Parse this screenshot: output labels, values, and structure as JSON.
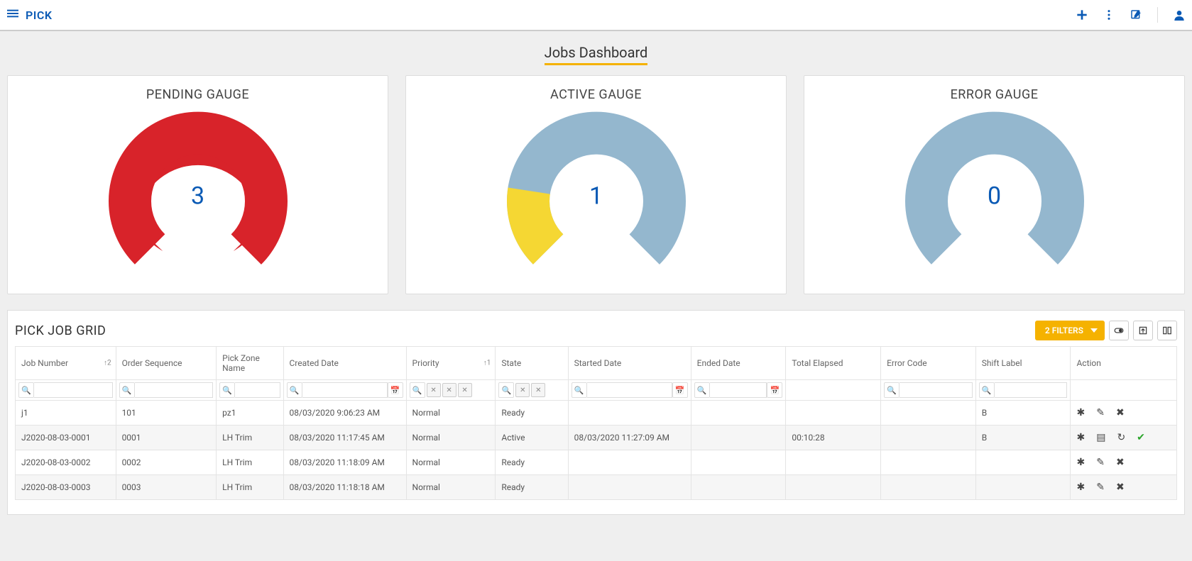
{
  "header": {
    "title": "PICK"
  },
  "dashboard": {
    "title": "Jobs Dashboard",
    "gauges": [
      {
        "label": "PENDING GAUGE",
        "value": "3"
      },
      {
        "label": "ACTIVE GAUGE",
        "value": "1"
      },
      {
        "label": "ERROR GAUGE",
        "value": "0"
      }
    ]
  },
  "grid": {
    "title": "PICK JOB GRID",
    "filters_label": "2 FILTERS",
    "columns": {
      "job_number": "Job Number",
      "order_sequence": "Order Sequence",
      "pick_zone": "Pick Zone Name",
      "created_date": "Created Date",
      "priority": "Priority",
      "state": "State",
      "started_date": "Started Date",
      "ended_date": "Ended Date",
      "total_elapsed": "Total Elapsed",
      "error_code": "Error Code",
      "shift_label": "Shift Label",
      "action": "Action",
      "sort_job": "↑2",
      "sort_prio": "↑1"
    },
    "rows": [
      {
        "job_number": "j1",
        "order_sequence": "101",
        "pick_zone": "pz1",
        "created_date": "08/03/2020 9:06:23 AM",
        "priority": "Normal",
        "state": "Ready",
        "started_date": "",
        "ended_date": "",
        "total_elapsed": "",
        "error_code": "",
        "shift_label": "B"
      },
      {
        "job_number": "J2020-08-03-0001",
        "order_sequence": "0001",
        "pick_zone": "LH Trim",
        "created_date": "08/03/2020 11:17:45 AM",
        "priority": "Normal",
        "state": "Active",
        "started_date": "08/03/2020 11:27:09 AM",
        "ended_date": "",
        "total_elapsed": "00:10:28",
        "error_code": "",
        "shift_label": "B"
      },
      {
        "job_number": "J2020-08-03-0002",
        "order_sequence": "0002",
        "pick_zone": "LH Trim",
        "created_date": "08/03/2020 11:18:09 AM",
        "priority": "Normal",
        "state": "Ready",
        "started_date": "",
        "ended_date": "",
        "total_elapsed": "",
        "error_code": "",
        "shift_label": ""
      },
      {
        "job_number": "J2020-08-03-0003",
        "order_sequence": "0003",
        "pick_zone": "LH Trim",
        "created_date": "08/03/2020 11:18:18 AM",
        "priority": "Normal",
        "state": "Ready",
        "started_date": "",
        "ended_date": "",
        "total_elapsed": "",
        "error_code": "",
        "shift_label": ""
      }
    ]
  },
  "chart_data": [
    {
      "type": "gauge",
      "title": "PENDING GAUGE",
      "value": 3,
      "fill_fraction": 1.0
    },
    {
      "type": "gauge",
      "title": "ACTIVE GAUGE",
      "value": 1,
      "fill_fraction_yellow": 0.2,
      "fill_fraction_blue": 0.8
    },
    {
      "type": "gauge",
      "title": "ERROR GAUGE",
      "value": 0,
      "fill_fraction": 1.0
    }
  ]
}
